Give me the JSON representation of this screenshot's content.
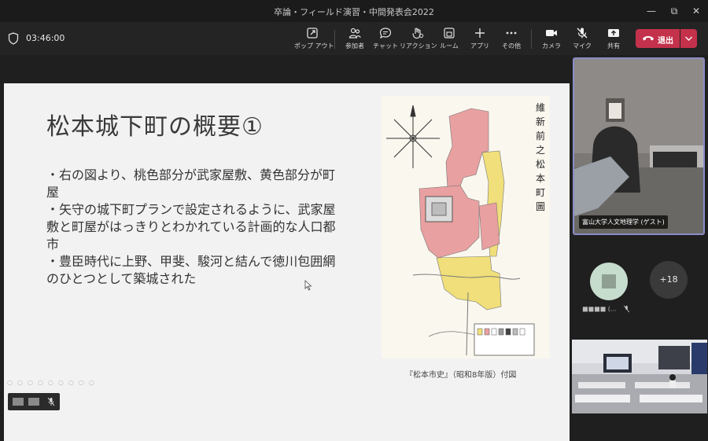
{
  "window": {
    "title": "卒論・フィールド演習・中間発表会2022"
  },
  "call": {
    "timer": "03:46:00"
  },
  "toolbar": {
    "buttons": [
      {
        "id": "popout",
        "label": "ポップ アウト"
      },
      {
        "id": "people",
        "label": "参加者"
      },
      {
        "id": "chat",
        "label": "チャット"
      },
      {
        "id": "react",
        "label": "リアクション"
      },
      {
        "id": "rooms",
        "label": "ルーム"
      },
      {
        "id": "apps",
        "label": "アプリ"
      },
      {
        "id": "more",
        "label": "その他"
      },
      {
        "id": "camera",
        "label": "カメラ"
      },
      {
        "id": "mic",
        "label": "マイク"
      },
      {
        "id": "share",
        "label": "共有"
      }
    ],
    "leave_label": "退出"
  },
  "slide": {
    "title": "松本城下町の概要①",
    "bullets": [
      "・右の図より、桃色部分が武家屋敷、黄色部分が町屋",
      "・矢守の城下町プランで設定されるように、武家屋敷と町屋がはっきりとわかれている計画的な人口都市",
      "・豊臣時代に上野、甲斐、駿河と結んで徳川包囲網のひとつとして築城された"
    ],
    "map_title": "維新前之松本町圖",
    "caption": "『松本市史』（昭和8年版）付図"
  },
  "participants": {
    "main_label": "富山大学人文地理学 (ゲスト)",
    "others_count": "+18",
    "avatar_name": "■■■■ (..."
  },
  "colors": {
    "leave": "#c4314b",
    "active_border": "#8b8cc7",
    "samurai_district": "#e9a0a0",
    "merchant_district": "#f0df7a"
  }
}
